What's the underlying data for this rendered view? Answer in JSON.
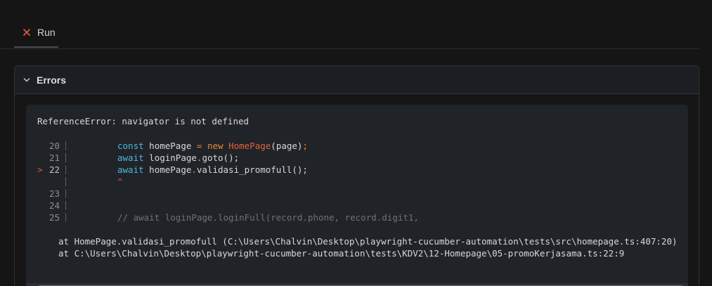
{
  "tab": {
    "label": "Run",
    "status_icon": "close-icon"
  },
  "panel": {
    "title": "Errors",
    "toggle_icon": "chevron-down-icon"
  },
  "error": {
    "message": "ReferenceError: navigator is not defined",
    "code_lines": [
      {
        "num": "20",
        "pointer": "",
        "tokens": [
          {
            "t": "const",
            "c": "kw"
          },
          {
            "t": " homePage ",
            "c": "pl"
          },
          {
            "t": "=",
            "c": "new"
          },
          {
            "t": " ",
            "c": "pl"
          },
          {
            "t": "new",
            "c": "new"
          },
          {
            "t": " ",
            "c": "pl"
          },
          {
            "t": "HomePage",
            "c": "cls"
          },
          {
            "t": "(page)",
            "c": "pl"
          },
          {
            "t": ";",
            "c": "new"
          }
        ]
      },
      {
        "num": "21",
        "pointer": "",
        "tokens": [
          {
            "t": "await",
            "c": "kw"
          },
          {
            "t": " loginPage",
            "c": "pl"
          },
          {
            "t": ".",
            "c": "new"
          },
          {
            "t": "goto();",
            "c": "pl"
          }
        ]
      },
      {
        "num": "22",
        "pointer": ">",
        "tokens": [
          {
            "t": "await",
            "c": "kw"
          },
          {
            "t": " homePage",
            "c": "pl"
          },
          {
            "t": ".",
            "c": "new"
          },
          {
            "t": "validasi_promofull();",
            "c": "pl"
          }
        ]
      },
      {
        "num": "",
        "pointer": "",
        "tokens": [
          {
            "t": "^",
            "c": "caret"
          }
        ]
      },
      {
        "num": "23",
        "pointer": "",
        "tokens": []
      },
      {
        "num": "24",
        "pointer": "",
        "tokens": []
      },
      {
        "num": "25",
        "pointer": "",
        "tokens": [
          {
            "t": "// await loginPage.loginFull(record.phone, record.digit1,",
            "c": "comment"
          }
        ]
      }
    ],
    "stack": [
      "at HomePage.validasi_promofull (C:\\Users\\Chalvin\\Desktop\\playwright-cucumber-automation\\tests\\src\\homepage.ts:407:20)",
      "at C:\\Users\\Chalvin\\Desktop\\playwright-cucumber-automation\\tests\\KDV2\\12-Homepage\\05-promoKerjasama.ts:22:9"
    ]
  },
  "colors": {
    "background": "#151515",
    "keyword": "#4fb6dc",
    "operator": "#e28b3b",
    "class_name": "#e0653c",
    "error_red": "#e05546",
    "comment": "#6e7379"
  }
}
